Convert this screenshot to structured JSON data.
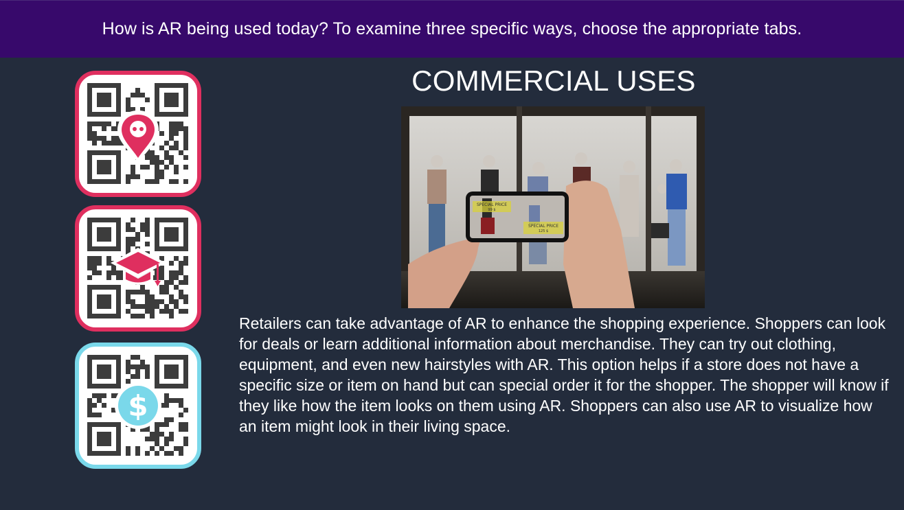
{
  "header": {
    "prompt": "How is AR being used today? To examine three specific ways, choose the appropriate tabs."
  },
  "tabs": [
    {
      "icon": "location-pin-icon",
      "border_color": "#df2f5f"
    },
    {
      "icon": "graduation-cap-icon",
      "border_color": "#df2f5f"
    },
    {
      "icon": "dollar-coin-icon",
      "border_color": "#7ad8ea"
    }
  ],
  "content": {
    "title": "COMMERCIAL USES",
    "image": {
      "labels": [
        {
          "line1": "SPECIAL PRICE",
          "line2": "99 $"
        },
        {
          "line1": "SPECIAL PRICE",
          "line2": "125 $"
        }
      ]
    },
    "body": "Retailers can take advantage of AR to enhance the shopping experience. Shoppers can look for deals or learn additional information about merchandise. They can try out clothing, equipment, and even new hairstyles with AR. This option helps if a store does not have a specific size or item on hand but can special order it for the shopper. The shopper will know if they like how the item looks on them using AR. Shoppers can also use AR to visualize how an item might look in their living space."
  },
  "colors": {
    "background": "#232c3c",
    "banner": "#37096b",
    "accent_pink": "#df2f5f",
    "accent_cyan": "#7ad8ea"
  }
}
